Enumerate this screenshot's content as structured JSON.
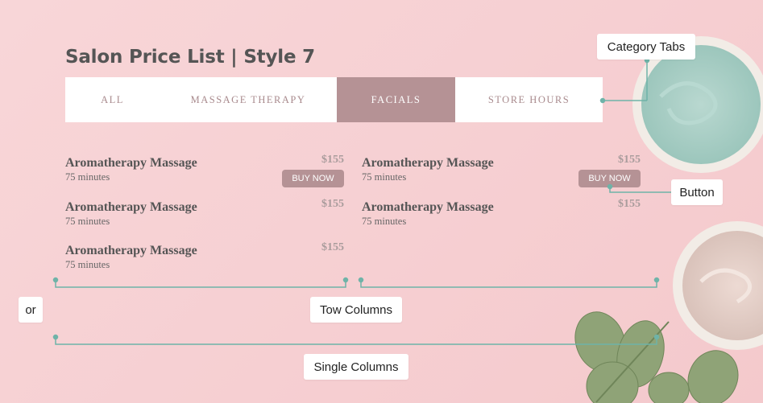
{
  "page": {
    "title": "Salon Price List | Style 7"
  },
  "tabs": [
    {
      "label": "ALL",
      "active": false
    },
    {
      "label": "MASSAGE THERAPY",
      "active": false
    },
    {
      "label": "FACIALS",
      "active": true
    },
    {
      "label": "STORE HOURS",
      "active": false
    }
  ],
  "left_column": [
    {
      "name": "Aromatherapy Massage",
      "duration": "75 minutes",
      "price": "$155",
      "button": "BUY NOW"
    },
    {
      "name": "Aromatherapy Massage",
      "duration": "75 minutes",
      "price": "$155"
    },
    {
      "name": "Aromatherapy Massage",
      "duration": "75 minutes",
      "price": "$155"
    }
  ],
  "right_column": [
    {
      "name": "Aromatherapy Massage",
      "duration": "75 minutes",
      "price": "$155",
      "button": "BUY NOW"
    },
    {
      "name": "Aromatherapy Massage",
      "duration": "75 minutes",
      "price": "$155"
    }
  ],
  "callouts": {
    "category_tabs": "Category Tabs",
    "button": "Button",
    "or": "or",
    "two_columns": "Tow Columns",
    "single_columns": "Single Columns"
  },
  "colors": {
    "accent": "#b59295",
    "annotation_line": "#6fb3a8",
    "background": "#f7d3d5"
  }
}
